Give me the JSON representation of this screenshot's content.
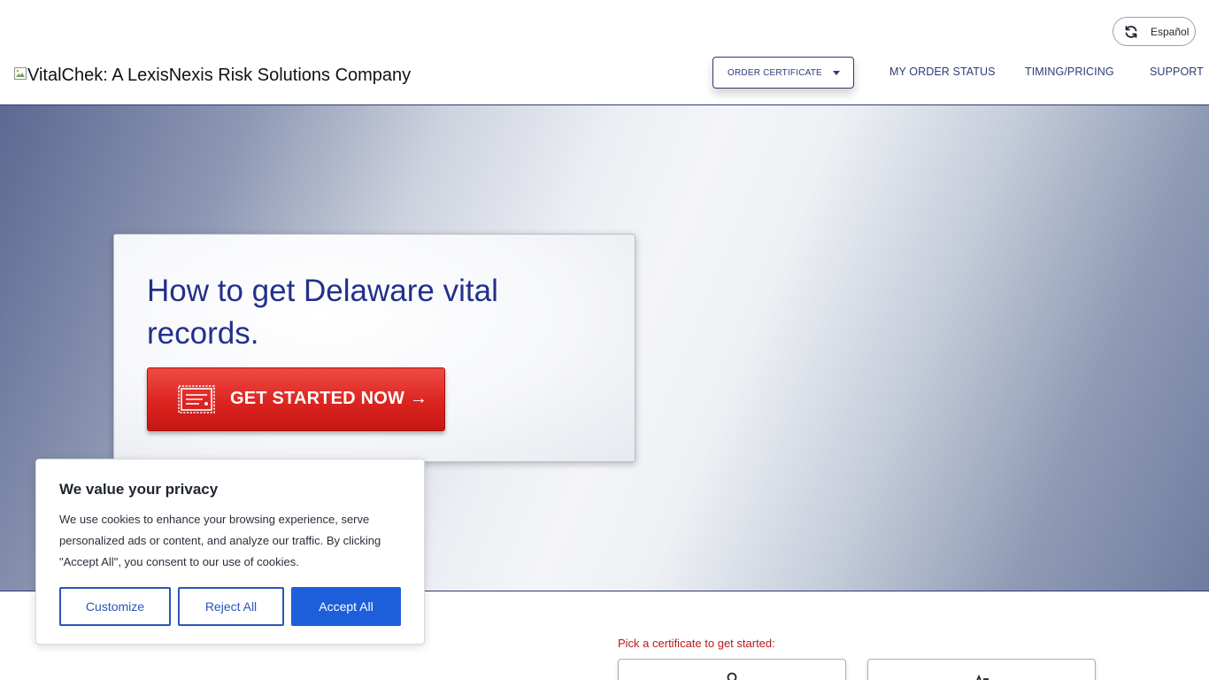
{
  "header": {
    "language_label": "Español",
    "logo_alt": "VitalChek: A LexisNexis Risk Solutions Company",
    "nav": {
      "order_certificate": "ORDER CERTIFICATE",
      "my_order_status": "MY ORDER STATUS",
      "timing_pricing": "TIMING/PRICING",
      "support": "SUPPORT"
    }
  },
  "hero": {
    "title": "How to get Delaware vital records.",
    "cta_label": "GET STARTED NOW →"
  },
  "main": {
    "pick_label": "Pick a certificate to get started:"
  },
  "cookie_banner": {
    "title": "We value your privacy",
    "text": "We use cookies to enhance your browsing experience, serve personalized ads or content, and analyze our traffic. By clicking \"Accept All\", you consent to our use of cookies.",
    "customize_label": "Customize",
    "reject_label": "Reject All",
    "accept_label": "Accept All"
  },
  "colors": {
    "brand_navy": "#2d3a78",
    "hero_title": "#22308a",
    "cta_red": "#dc2420",
    "accent_blue": "#1d5edb",
    "pick_label_red": "#c0161a"
  },
  "icons": {
    "language": "refresh-icon",
    "logo": "broken-image-icon",
    "dropdown": "caret-down-icon",
    "cta": "certificate-icon"
  }
}
